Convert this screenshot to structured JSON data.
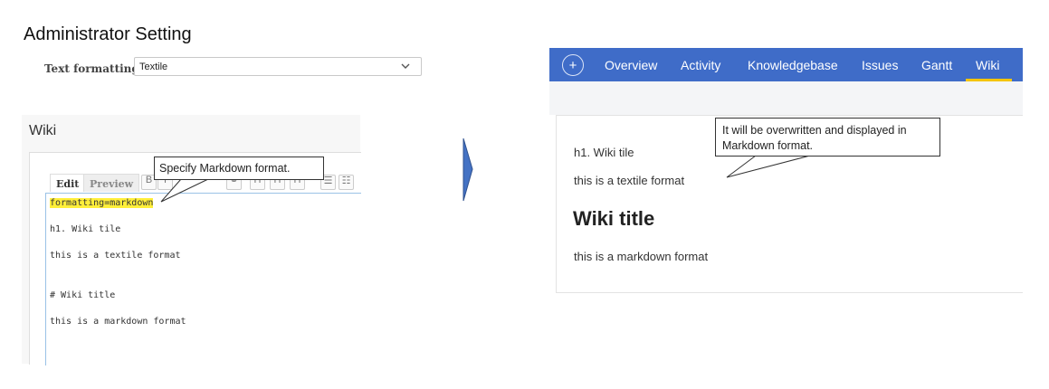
{
  "admin": {
    "title": "Administrator Setting",
    "text_formatting_label": "Text formatting",
    "text_formatting_value": "Textile"
  },
  "editor": {
    "heading": "Wiki",
    "tabs": {
      "edit": "Edit",
      "preview": "Preview"
    },
    "lines": [
      "formatting=markdown",
      "h1. Wiki tile",
      "this is a textile format",
      "# Wiki title",
      "this is a markdown format"
    ],
    "callout": "Specify Markdown format."
  },
  "navbar": {
    "plus": "+",
    "tabs": [
      "Overview",
      "Activity",
      "Knowledgebase",
      "Issues",
      "Gantt",
      "Wiki"
    ],
    "active_tab": "Wiki",
    "accent_color": "#f5c400",
    "bg_color": "#3f6cc8"
  },
  "rendered": {
    "line1": "h1. Wiki tile",
    "line2": "this is a textile format",
    "title": "Wiki title",
    "line3": "this is a markdown format",
    "callout": "It will be overwritten and displayed in Markdown format."
  }
}
